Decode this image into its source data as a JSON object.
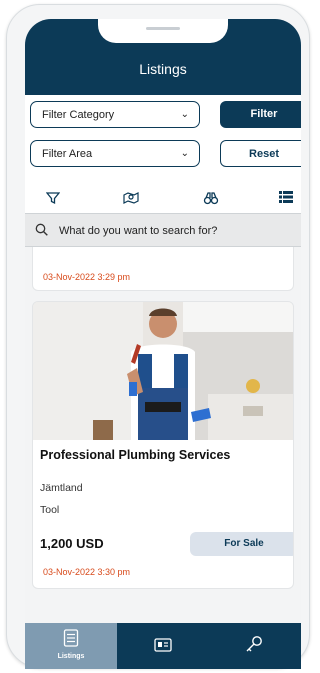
{
  "header": {
    "title": "Listings"
  },
  "filters": {
    "category": "Filter Category",
    "area": "Filter Area",
    "filter_label": "Filter",
    "reset_label": "Reset",
    "icons": [
      "funnel-icon",
      "map-icon",
      "binoculars-icon",
      "list-icon"
    ]
  },
  "search": {
    "placeholder": "What do you want to search for?"
  },
  "previous_listing": {
    "date": "03-Nov-2022 3:29 pm"
  },
  "listing": {
    "title": "Professional Plumbing Services",
    "location": "Jämtland",
    "category": "Tool",
    "price": "1,200 USD",
    "status": "For Sale",
    "date": "03-Nov-2022 3:30 pm",
    "image": "plumber-photo"
  },
  "tabbar": {
    "tabs": [
      {
        "label": "Listings",
        "icon": "listings-icon",
        "active": true
      },
      {
        "label": "",
        "icon": "id-card-icon",
        "active": false
      },
      {
        "label": "",
        "icon": "key-icon",
        "active": false
      }
    ]
  },
  "colors": {
    "primary": "#0c3a57",
    "active_tab": "#7f9bb1",
    "date_accent": "#d84a1b",
    "badge_bg": "#dbe2eb"
  }
}
